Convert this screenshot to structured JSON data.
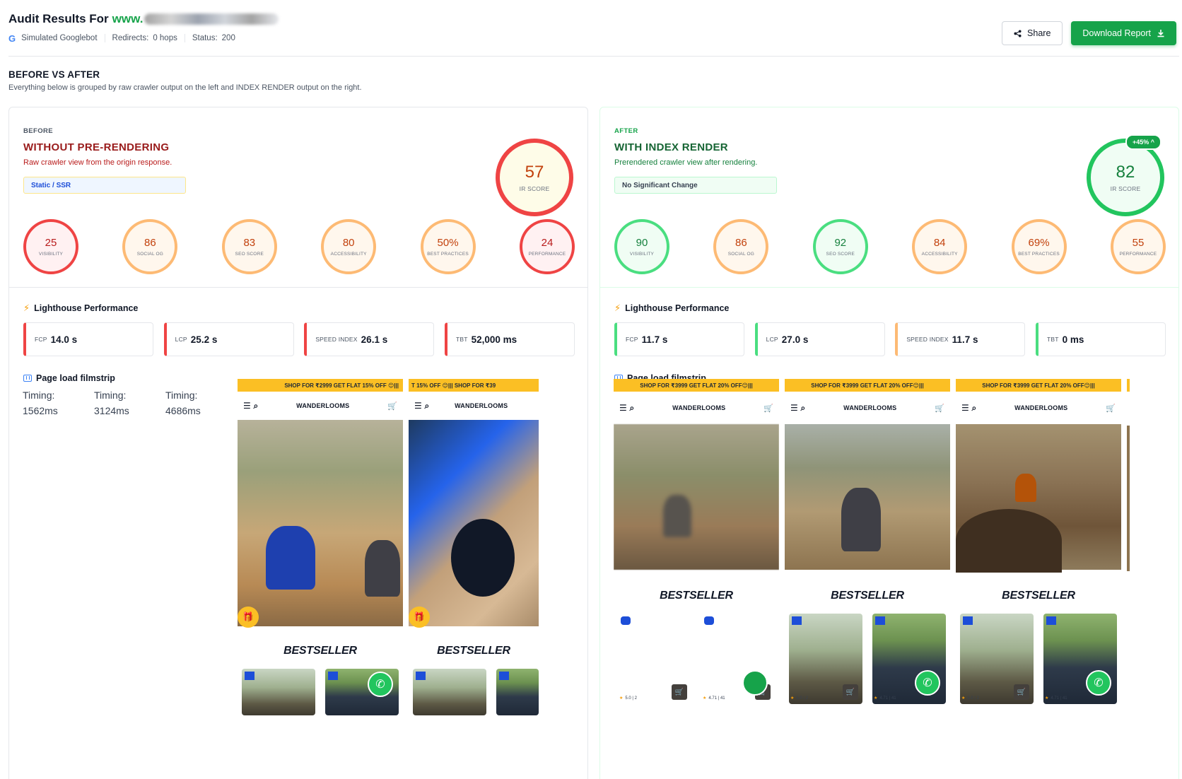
{
  "header": {
    "title_prefix": "Audit Results For",
    "domain": "www.",
    "google_logo": "G",
    "crawler": "Simulated Googlebot",
    "redirects_label": "Redirects:",
    "redirects_value": "0 hops",
    "status_label": "Status:",
    "status_value": "200",
    "share_label": "Share",
    "download_label": "Download Report"
  },
  "section": {
    "title": "BEFORE VS AFTER",
    "subtitle": "Everything below is grouped by raw crawler output on the left and INDEX RENDER output on the right."
  },
  "before": {
    "tag": "BEFORE",
    "title": "WITHOUT PRE-RENDERING",
    "subtitle": "Raw crawler view from the origin response.",
    "chip": "Static / SSR",
    "ir_score": "57",
    "ir_label": "IR SCORE",
    "scores": [
      {
        "value": "25",
        "label": "VISIBILITY",
        "status": "red"
      },
      {
        "value": "86",
        "label": "SOCIAL OG",
        "status": "orange"
      },
      {
        "value": "83",
        "label": "SEO SCORE",
        "status": "orange"
      },
      {
        "value": "80",
        "label": "ACCESSIBILITY",
        "status": "orange"
      },
      {
        "value": "50%",
        "label": "BEST PRACTICES",
        "status": "orange"
      },
      {
        "value": "24",
        "label": "PERFORMANCE",
        "status": "red"
      }
    ],
    "lighthouse_title": "Lighthouse Performance",
    "metrics": [
      {
        "key": "FCP",
        "value": "14.0 s",
        "status": "red"
      },
      {
        "key": "LCP",
        "value": "25.2 s",
        "status": "red"
      },
      {
        "key": "SPEED INDEX",
        "value": "26.1 s",
        "status": "red"
      },
      {
        "key": "TBT",
        "value": "52,000 ms",
        "status": "red"
      }
    ],
    "filmstrip_title": "Page load filmstrip",
    "timings": [
      "Timing: 1562ms",
      "Timing: 3124ms",
      "Timing: 4686ms"
    ],
    "frames": [
      {
        "promo": "SHOP FOR ₹2999 GET FLAT 15% OFF 😊|||",
        "logo": "WANDERLOOMS",
        "bestseller": "BESTSELLER"
      },
      {
        "promo": "T 15% OFF 😊|||          SHOP FOR ₹39",
        "logo": "WANDERLOOMS",
        "bestseller": "BESTSELLER"
      }
    ]
  },
  "after": {
    "tag": "AFTER",
    "title": "WITH INDEX RENDER",
    "subtitle": "Prerendered crawler view after rendering.",
    "chip": "No Significant Change",
    "ir_score": "82",
    "ir_label": "IR SCORE",
    "badge": "+45% ^",
    "scores": [
      {
        "value": "90",
        "label": "VISIBILITY",
        "status": "green"
      },
      {
        "value": "86",
        "label": "SOCIAL OG",
        "status": "orange"
      },
      {
        "value": "92",
        "label": "SEO SCORE",
        "status": "green"
      },
      {
        "value": "84",
        "label": "ACCESSIBILITY",
        "status": "orange"
      },
      {
        "value": "69%",
        "label": "BEST PRACTICES",
        "status": "orange"
      },
      {
        "value": "55",
        "label": "PERFORMANCE",
        "status": "orange"
      }
    ],
    "lighthouse_title": "Lighthouse Performance",
    "metrics": [
      {
        "key": "FCP",
        "value": "11.7 s",
        "status": "green"
      },
      {
        "key": "LCP",
        "value": "27.0 s",
        "status": "green"
      },
      {
        "key": "SPEED INDEX",
        "value": "11.7 s",
        "status": "orange"
      },
      {
        "key": "TBT",
        "value": "0 ms",
        "status": "green"
      }
    ],
    "filmstrip_title": "Page load filmstrip",
    "frames": [
      {
        "promo": "SHOP FOR ₹3999 GET FLAT 20% OFF😊|||",
        "logo": "WANDERLOOMS",
        "bestseller": "BESTSELLER",
        "r1": "5.0 | 2",
        "r2": "4.71 | 41"
      },
      {
        "promo": "SHOP FOR ₹3999 GET FLAT 20% OFF😊|||",
        "logo": "WANDERLOOMS",
        "bestseller": "BESTSELLER",
        "r1": "5.0 | 2",
        "r2": "4.71 | 41"
      },
      {
        "promo": "SHOP FOR ₹3999 GET FLAT 20% OFF😊|||",
        "logo": "WANDERLOOMS",
        "bestseller": "BESTSELLER",
        "r1": "5.0 | 2",
        "r2": "4.71 | 41"
      }
    ]
  },
  "colors": {
    "accent_green": "#16a34a",
    "bad_red": "#ef4444",
    "warn_orange": "#fdba74",
    "good_green": "#4ade80"
  },
  "icons": {
    "share": "share-icon",
    "download": "download-icon",
    "bolt": "bolt-icon",
    "film": "filmstrip-icon"
  }
}
